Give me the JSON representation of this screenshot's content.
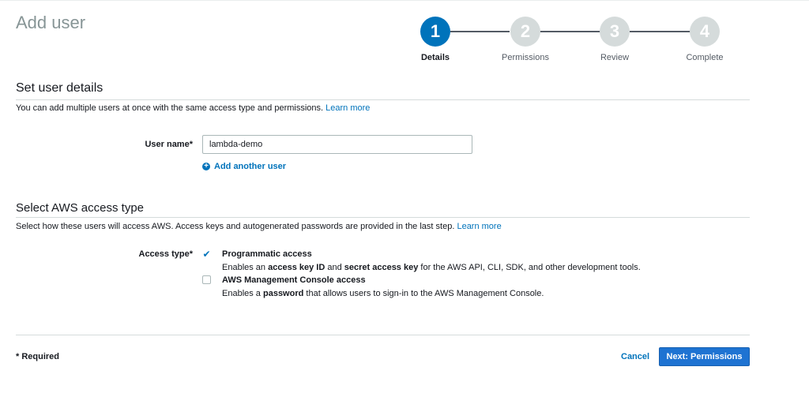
{
  "page": {
    "title": "Add user"
  },
  "stepper": {
    "steps": [
      {
        "number": "1",
        "label": "Details"
      },
      {
        "number": "2",
        "label": "Permissions"
      },
      {
        "number": "3",
        "label": "Review"
      },
      {
        "number": "4",
        "label": "Complete"
      }
    ],
    "active_step": 1
  },
  "user_details": {
    "heading": "Set user details",
    "description": "You can add multiple users at once with the same access type and permissions.",
    "learn_more": "Learn more",
    "username_label": "User name*",
    "username_value": "lambda-demo",
    "add_another_label": "Add another user"
  },
  "access_type": {
    "heading": "Select AWS access type",
    "description": "Select how these users will access AWS. Access keys and autogenerated passwords are provided in the last step.",
    "learn_more": "Learn more",
    "label": "Access type*",
    "options": [
      {
        "title": "Programmatic access",
        "checked": true,
        "desc_prefix": "Enables an ",
        "desc_bold1": "access key ID",
        "desc_mid": " and ",
        "desc_bold2": "secret access key",
        "desc_suffix": " for the AWS API, CLI, SDK, and other development tools."
      },
      {
        "title": "AWS Management Console access",
        "checked": false,
        "desc_prefix": "Enables a ",
        "desc_bold1": "password",
        "desc_suffix": " that allows users to sign-in to the AWS Management Console."
      }
    ]
  },
  "footer": {
    "required_note": "* Required",
    "cancel_label": "Cancel",
    "next_label": "Next: Permissions"
  },
  "colors": {
    "accent": "#0073bb",
    "primary_button": "#1e73d2",
    "inactive_step": "#d5dbdb"
  }
}
